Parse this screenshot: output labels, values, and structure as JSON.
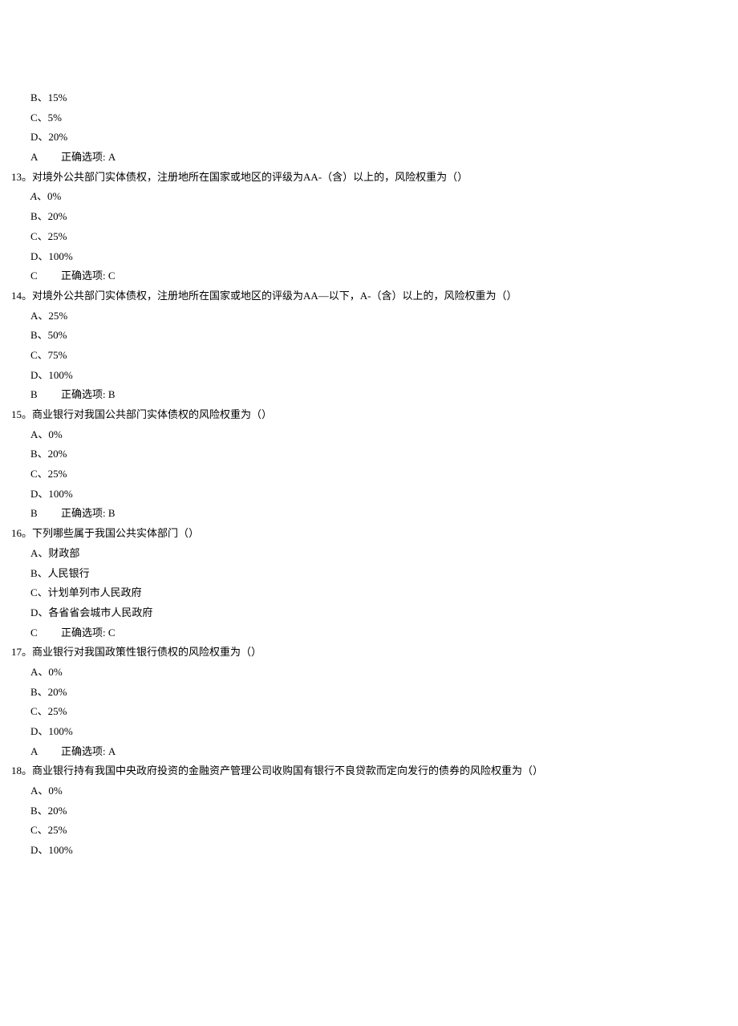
{
  "partial_q12": {
    "opts": {
      "b": "B、15%",
      "c": "C、5%",
      "d": "D、20%"
    },
    "answer_letter": "A",
    "answer_text": "正确选项: A"
  },
  "q13": {
    "num": "13。",
    "stem": "对境外公共部门实体债权，注册地所在国家或地区的评级为AA-（含）以上的，风险权重为（）",
    "opts": {
      "a_label": "A",
      "a_val": "、0%",
      "b": "B、20%",
      "c": "C、25%",
      "d": "D、100%"
    },
    "answer_letter": "C",
    "answer_text": "正确选项: C"
  },
  "q14": {
    "num": "14。",
    "stem": "对境外公共部门实体债权，注册地所在国家或地区的评级为AA—以下，A-（含）以上的，风险权重为（）",
    "opts": {
      "a": "A、25%",
      "b": "B、50%",
      "c": "C、75%",
      "d": "D、100%"
    },
    "answer_letter": "B",
    "answer_text": "正确选项: B"
  },
  "q15": {
    "num": "15。",
    "stem": "商业银行对我国公共部门实体债权的风险权重为（）",
    "opts": {
      "a": "A、0%",
      "b": "B、20%",
      "c": "C、25%",
      "d": "D、100%"
    },
    "answer_letter": "B",
    "answer_text": "正确选项: B"
  },
  "q16": {
    "num": "16。",
    "stem": "下列哪些属于我国公共实体部门（）",
    "opts": {
      "a": "A、财政部",
      "b": "B、人民银行",
      "c": "C、计划单列市人民政府",
      "d": "D、各省省会城市人民政府"
    },
    "answer_letter": "C",
    "answer_text": "正确选项: C"
  },
  "q17": {
    "num": "17。",
    "stem": "商业银行对我国政策性银行债权的风险权重为（）",
    "opts": {
      "a": "A、0%",
      "b": "B、20%",
      "c": "C、25%",
      "d": "D、100%"
    },
    "answer_letter": "A",
    "answer_text": "正确选项: A"
  },
  "q18": {
    "num": "18。",
    "stem": "商业银行持有我国中央政府投资的金融资产管理公司收购国有银行不良贷款而定向发行的债券的风险权重为（）",
    "opts": {
      "a": "A、0%",
      "b": "B、20%",
      "c": "C、25%",
      "d": "D、100%"
    }
  }
}
